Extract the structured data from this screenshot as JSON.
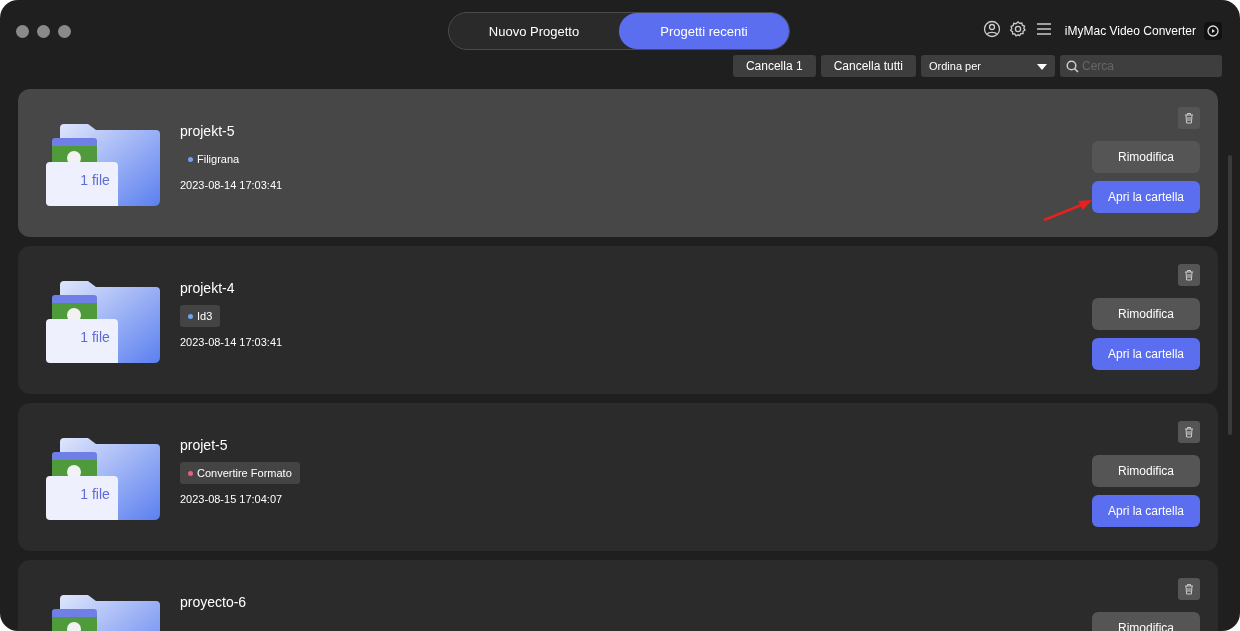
{
  "window": {
    "app_name": "iMyMac Video Converter"
  },
  "tabs": [
    {
      "label": "Nuovo Progetto",
      "selected": false
    },
    {
      "label": "Progetti recenti",
      "selected": true
    }
  ],
  "toolbar": {
    "buttons": [
      "Cancella 1",
      "Cancella tutti"
    ],
    "sort": {
      "value": "Ordina per"
    },
    "search": {
      "placeholder": "Cerca"
    }
  },
  "projects": [
    {
      "name": "projekt-5",
      "file_count": "1 file",
      "tag": {
        "label": "Filigrana",
        "color": "#6fa3f0"
      },
      "date": "2023-08-14 17:03:41",
      "selected": true,
      "buttons": [
        "Rimodifica",
        "Apri la cartella"
      ]
    },
    {
      "name": "projekt-4",
      "file_count": "1 file",
      "tag": {
        "label": "Id3",
        "color": "#6fa3f0"
      },
      "date": "2023-08-14 17:03:41",
      "selected": false,
      "buttons": [
        "Rimodifica",
        "Apri la cartella"
      ]
    },
    {
      "name": "projet-5",
      "file_count": "1 file",
      "tag": {
        "label": "Convertire Formato",
        "color": "#e8607a"
      },
      "date": "2023-08-15 17:04:07",
      "selected": false,
      "buttons": [
        "Rimodifica",
        "Apri la cartella"
      ]
    },
    {
      "name": "proyecto-6",
      "selected": false,
      "buttons": [
        "Rimodifica"
      ]
    }
  ]
}
